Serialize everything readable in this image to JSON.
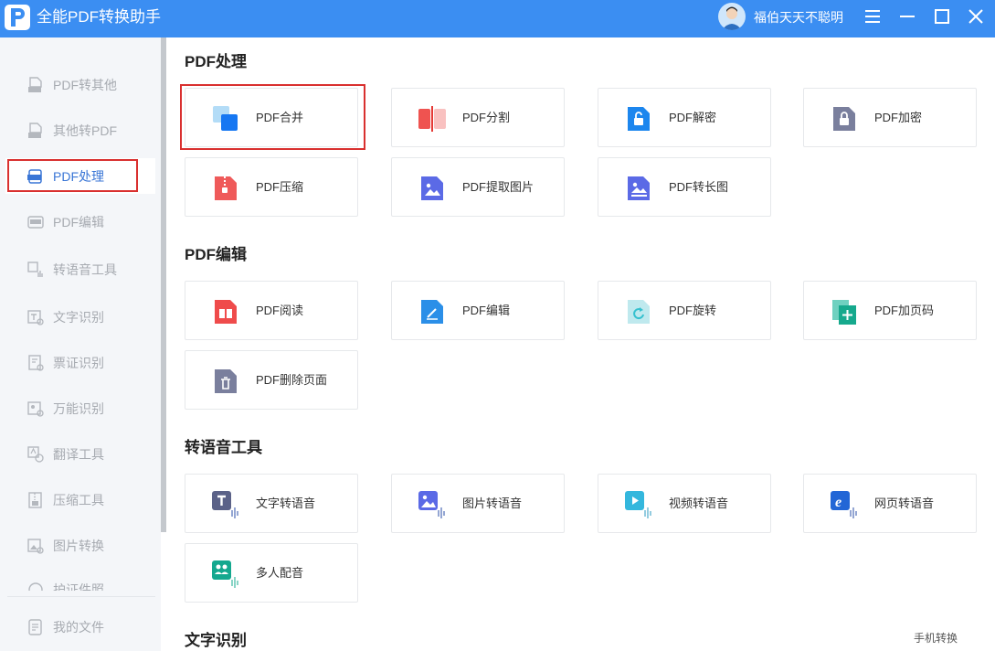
{
  "app": {
    "title": "全能PDF转换助手",
    "username": "福伯天天不聪明"
  },
  "window_controls": [
    "menu-icon",
    "minimize-icon",
    "maximize-icon",
    "close-icon"
  ],
  "sidebar": {
    "items": [
      {
        "label": "PDF转其他",
        "icon": "pdf-doc-icon"
      },
      {
        "label": "其他转PDF",
        "icon": "pdf-doc-icon"
      },
      {
        "label": "PDF处理",
        "icon": "pdf-process-icon",
        "active": true
      },
      {
        "label": "PDF编辑",
        "icon": "pdf-edit-icon"
      },
      {
        "label": "转语音工具",
        "icon": "voice-tool-icon"
      },
      {
        "label": "文字识别",
        "icon": "text-ocr-icon"
      },
      {
        "label": "票证识别",
        "icon": "ticket-ocr-icon"
      },
      {
        "label": "万能识别",
        "icon": "universal-ocr-icon"
      },
      {
        "label": "翻译工具",
        "icon": "translate-icon"
      },
      {
        "label": "压缩工具",
        "icon": "compress-icon"
      },
      {
        "label": "图片转换",
        "icon": "image-convert-icon"
      },
      {
        "label": "护证件照",
        "icon": "id-photo-icon"
      }
    ],
    "footer": {
      "label": "我的文件",
      "icon": "my-files-icon"
    }
  },
  "sections": [
    {
      "title": "PDF处理",
      "cards": [
        {
          "label": "PDF合并",
          "icon": "merge-icon"
        },
        {
          "label": "PDF分割",
          "icon": "split-icon"
        },
        {
          "label": "PDF解密",
          "icon": "unlock-icon"
        },
        {
          "label": "PDF加密",
          "icon": "lock-icon"
        },
        {
          "label": "PDF压缩",
          "icon": "zip-icon"
        },
        {
          "label": "PDF提取图片",
          "icon": "image-extract-icon"
        },
        {
          "label": "PDF转长图",
          "icon": "long-image-icon"
        }
      ]
    },
    {
      "title": "PDF编辑",
      "cards": [
        {
          "label": "PDF阅读",
          "icon": "read-icon"
        },
        {
          "label": "PDF编辑",
          "icon": "edit-icon"
        },
        {
          "label": "PDF旋转",
          "icon": "rotate-icon"
        },
        {
          "label": "PDF加页码",
          "icon": "page-number-icon"
        },
        {
          "label": "PDF删除页面",
          "icon": "delete-page-icon"
        }
      ]
    },
    {
      "title": "转语音工具",
      "cards": [
        {
          "label": "文字转语音",
          "icon": "text-to-speech-icon"
        },
        {
          "label": "图片转语音",
          "icon": "image-to-speech-icon"
        },
        {
          "label": "视频转语音",
          "icon": "video-to-speech-icon"
        },
        {
          "label": "网页转语音",
          "icon": "web-to-speech-icon"
        },
        {
          "label": "多人配音",
          "icon": "multi-voice-icon"
        }
      ]
    },
    {
      "title": "文字识别",
      "cards": []
    }
  ],
  "phone_convert": "手机转换",
  "colors": {
    "titlebar": "#3b8ef2",
    "highlight": "#d9302f",
    "sidebar_bg": "#f4f6f9"
  }
}
